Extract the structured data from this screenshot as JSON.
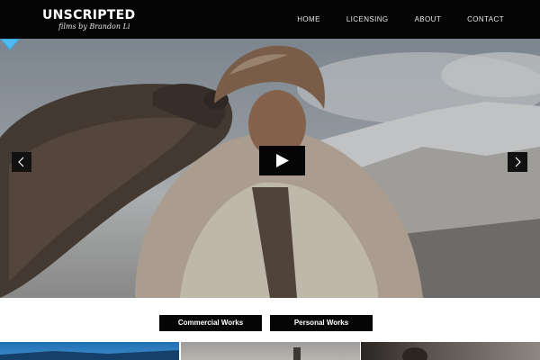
{
  "brand": {
    "name": "UNSCRIPTED",
    "tagline": "films by Brandon Li"
  },
  "nav": {
    "items": [
      {
        "label": "HOME"
      },
      {
        "label": "LICENSING"
      },
      {
        "label": "ABOUT"
      },
      {
        "label": "CONTACT"
      }
    ]
  },
  "hero": {
    "prev_icon": "chevron-left-icon",
    "next_icon": "chevron-right-icon",
    "play_icon": "play-icon",
    "scroll_icon": "triangle-down-icon",
    "accent_color": "#35a8e0"
  },
  "works": {
    "commercial_label": "Commercial Works",
    "personal_label": "Personal Works"
  },
  "colors": {
    "header_bg": "#050505",
    "button_bg": "#050505",
    "text_light": "#ffffff"
  }
}
